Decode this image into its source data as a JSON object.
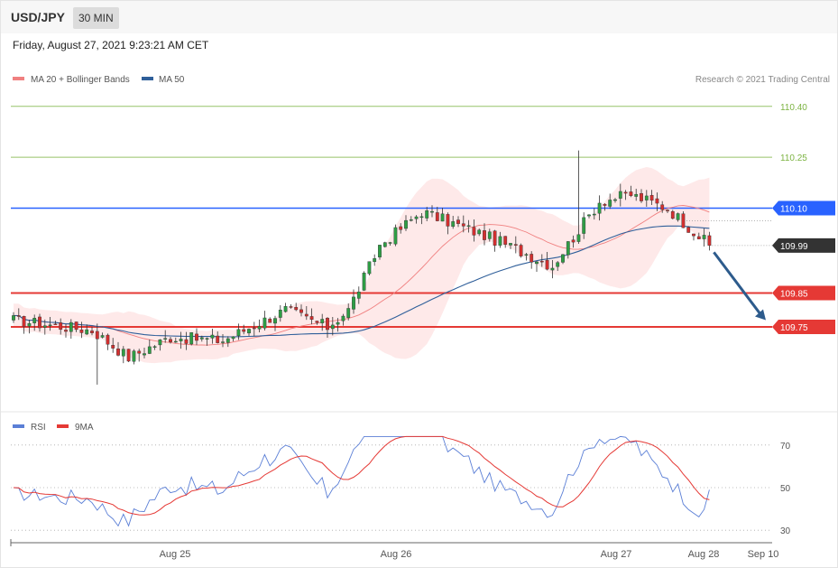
{
  "header": {
    "symbol": "USD/JPY",
    "timeframe": "30 MIN",
    "datetime": "Friday, August 27, 2021 9:23:21 AM CET"
  },
  "chart_data": [
    {
      "type": "candlestick",
      "legend": [
        {
          "label": "MA 20 + Bollinger Bands",
          "color": "#f08080"
        },
        {
          "label": "MA 50",
          "color": "#2f5f9a"
        }
      ],
      "legend_position": "top-left",
      "copyright": "Research © 2021 Trading Central",
      "x_tick_labels": [
        "Aug 25",
        "Aug 26",
        "Aug 27",
        "Aug 28",
        "Sep 10"
      ],
      "y_range": [
        109.5,
        110.45
      ],
      "last_price": {
        "value": 109.99,
        "label": "109.99",
        "color": "#333333"
      },
      "levels": [
        {
          "value": 110.4,
          "label": "110.40",
          "color": "#7cb342",
          "kind": "target",
          "badge": false
        },
        {
          "value": 110.25,
          "label": "110.25",
          "color": "#7cb342",
          "kind": "target",
          "badge": false
        },
        {
          "value": 110.1,
          "label": "110.10",
          "color": "#2962ff",
          "kind": "pivot",
          "badge": true
        },
        {
          "value": 109.85,
          "label": "109.85",
          "color": "#e53935",
          "kind": "support",
          "badge": true
        },
        {
          "value": 109.75,
          "label": "109.75",
          "color": "#e53935",
          "kind": "support",
          "badge": true
        }
      ],
      "forecast_arrow": {
        "from": 109.97,
        "to": 109.77,
        "color": "#2d5b8c"
      },
      "candles_summary": {
        "start": 109.77,
        "low": 109.58,
        "high": 110.27,
        "end": 109.99
      }
    },
    {
      "type": "line",
      "legend": [
        {
          "label": "RSI",
          "color": "#5b7fd6"
        },
        {
          "label": "9MA",
          "color": "#e53935"
        }
      ],
      "y_range": [
        25,
        75
      ],
      "y_tick_labels": [
        "70",
        "50",
        "30"
      ],
      "reference_lines": [
        70,
        50,
        30
      ],
      "rsi_current": 49
    }
  ]
}
